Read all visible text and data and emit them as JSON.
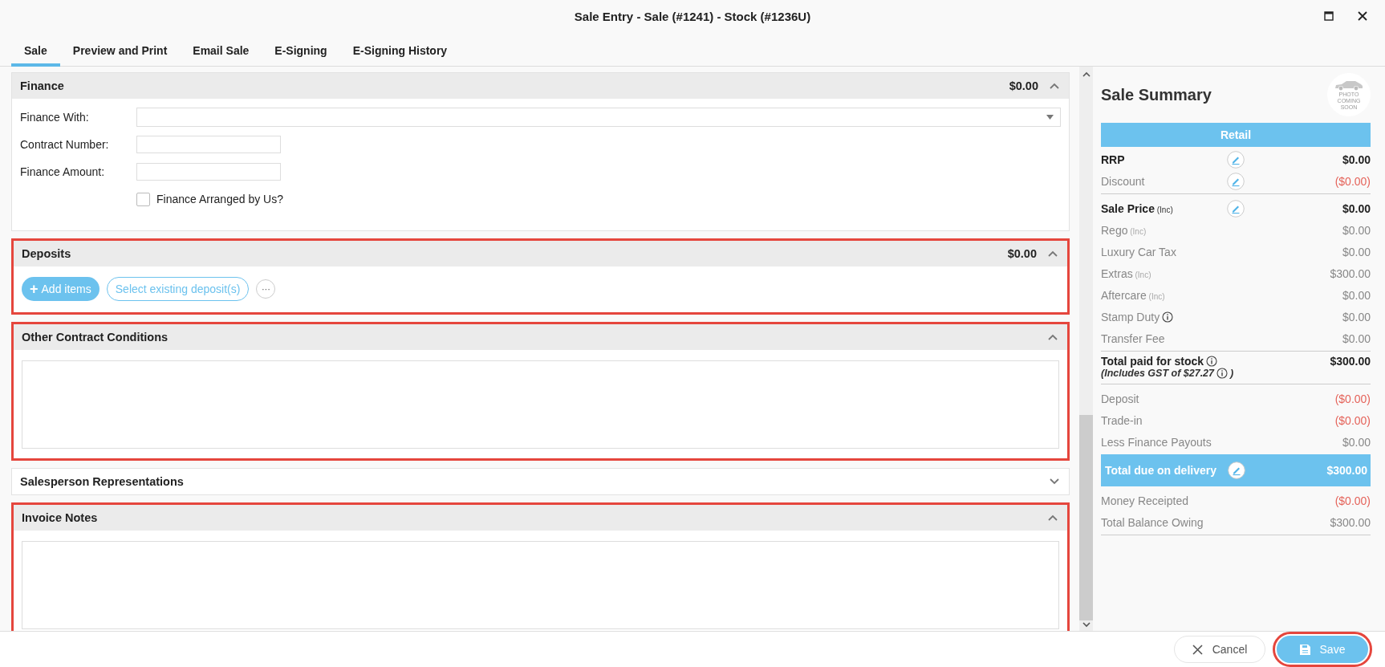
{
  "window": {
    "title": "Sale Entry - Sale (#1241) - Stock (#1236U)"
  },
  "tabs": [
    {
      "label": "Sale",
      "selected": true
    },
    {
      "label": "Preview and Print",
      "selected": false
    },
    {
      "label": "Email Sale",
      "selected": false
    },
    {
      "label": "E-Signing",
      "selected": false
    },
    {
      "label": "E-Signing History",
      "selected": false
    }
  ],
  "sections": [
    {
      "kind": "finance",
      "title": "Finance",
      "amount": "$0.00",
      "expanded": true,
      "highlighted": false,
      "fields": [
        {
          "kind": "select",
          "label": "Finance With:"
        },
        {
          "kind": "text",
          "label": "Contract Number:"
        },
        {
          "kind": "text",
          "label": "Finance Amount:"
        },
        {
          "kind": "checkbox",
          "label": "Finance Arranged by Us?",
          "checked": false
        }
      ]
    },
    {
      "kind": "deposits",
      "title": "Deposits",
      "amount": "$0.00",
      "expanded": true,
      "highlighted": true,
      "buttons": [
        {
          "kind": "primary",
          "label": "Add items",
          "icon": "+"
        },
        {
          "kind": "outline",
          "label": "Select existing deposit(s)"
        },
        {
          "kind": "more",
          "label": "···"
        }
      ]
    },
    {
      "kind": "notes",
      "title": "Other Contract Conditions",
      "expanded": true,
      "highlighted": true
    },
    {
      "title": "Salesperson Representations",
      "expanded": false,
      "highlighted": false
    },
    {
      "kind": "notes",
      "title": "Invoice Notes",
      "expanded": true,
      "highlighted": true
    }
  ],
  "summary": {
    "title": "Sale Summary",
    "photo_text": "PHOTO COMING SOON",
    "band": "Retail",
    "rows": [
      {
        "kind": "primary",
        "label": "RRP",
        "value": "$0.00",
        "editable": true,
        "negative": false
      },
      {
        "kind": "secondary",
        "label": "Discount",
        "value": "($0.00)",
        "editable": true,
        "negative": true,
        "divider": true
      },
      {
        "kind": "primary",
        "label": "Sale Price",
        "suffix": "(Inc)",
        "value": "$0.00",
        "editable": true,
        "negative": false
      },
      {
        "kind": "secondary",
        "label": "Rego",
        "suffix": "(Inc)",
        "value": "$0.00",
        "negative": false
      },
      {
        "kind": "secondary",
        "label": "Luxury Car Tax",
        "value": "$0.00",
        "negative": false
      },
      {
        "kind": "secondary",
        "label": "Extras",
        "suffix": "(Inc)",
        "value": "$300.00",
        "negative": false
      },
      {
        "kind": "secondary",
        "label": "Aftercare",
        "suffix": "(Inc)",
        "value": "$0.00",
        "negative": false
      },
      {
        "kind": "secondary",
        "label": "Stamp Duty",
        "info": true,
        "value": "$0.00",
        "negative": false
      },
      {
        "kind": "secondary",
        "label": "Transfer Fee",
        "value": "$0.00",
        "negative": false,
        "divider": true
      },
      {
        "kind": "primary",
        "label": "Total paid for stock",
        "info": true,
        "value": "$300.00",
        "negative": false,
        "note": "(Includes GST of $27.27",
        "note_end": ")",
        "divider": true
      },
      {
        "kind": "secondary",
        "label": "Deposit",
        "value": "($0.00)",
        "negative": true
      },
      {
        "kind": "secondary",
        "label": "Trade-in",
        "value": "($0.00)",
        "negative": true
      },
      {
        "kind": "secondary",
        "label": "Less Finance Payouts",
        "value": "$0.00",
        "negative": false
      },
      {
        "kind": "total",
        "label": "Total due on delivery",
        "value": "$300.00",
        "editable": true,
        "negative": false
      },
      {
        "kind": "secondary",
        "label": "Money Receipted",
        "value": "($0.00)",
        "negative": true
      },
      {
        "kind": "secondary",
        "label": "Total Balance Owing",
        "value": "$300.00",
        "negative": false,
        "divider": true
      }
    ]
  },
  "footer": {
    "buttons": [
      {
        "kind": "cancel",
        "label": "Cancel",
        "highlighted": false
      },
      {
        "kind": "save",
        "label": "Save",
        "highlighted": true
      }
    ]
  }
}
